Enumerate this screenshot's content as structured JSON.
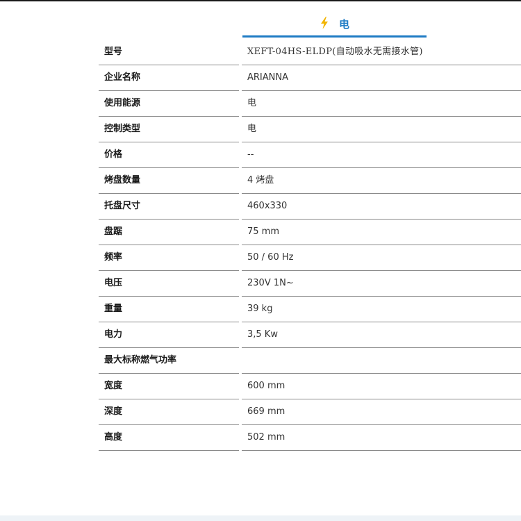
{
  "tab": {
    "label": "电",
    "icon": "lightning-bolt-icon"
  },
  "colors": {
    "accent": "#1e7bc4",
    "bolt": "#f2b400"
  },
  "specs": [
    {
      "label": "型号",
      "value": "XEFT-04HS-ELDP(自动吸水无需接水管)"
    },
    {
      "label": "企业名称",
      "value": "ARIANNA"
    },
    {
      "label": "使用能源",
      "value": "电"
    },
    {
      "label": "控制类型",
      "value": "电"
    },
    {
      "label": "价格",
      "value": "--"
    },
    {
      "label": "烤盘数量",
      "value": "4 烤盘"
    },
    {
      "label": "托盘尺寸",
      "value": "460x330"
    },
    {
      "label": "盘踞",
      "value": "75 mm"
    },
    {
      "label": "频率",
      "value": "50 / 60 Hz"
    },
    {
      "label": "电压",
      "value": "230V 1N~"
    },
    {
      "label": "重量",
      "value": "39 kg"
    },
    {
      "label": "电力",
      "value": "3,5 Kw"
    },
    {
      "label": "最大标称燃气功率",
      "value": ""
    },
    {
      "label": "宽度",
      "value": "600 mm"
    },
    {
      "label": "深度",
      "value": "669 mm"
    },
    {
      "label": "高度",
      "value": "502 mm"
    }
  ]
}
